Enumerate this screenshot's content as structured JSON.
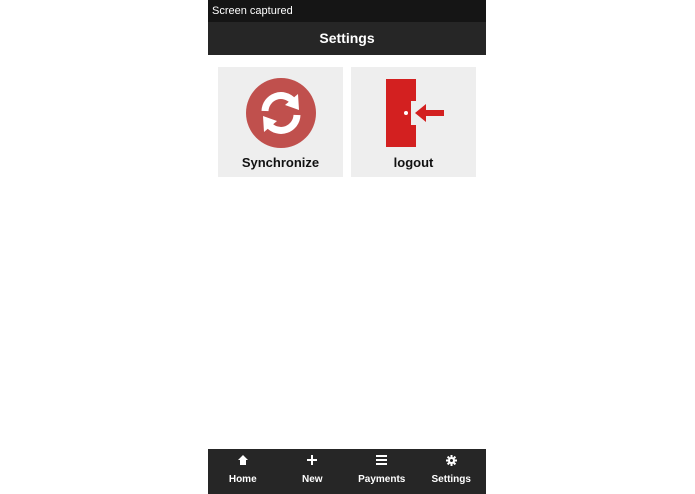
{
  "status_bar": {
    "text": "Screen captured"
  },
  "header": {
    "title": "Settings"
  },
  "tiles": [
    {
      "label": "Synchronize",
      "icon": "sync-icon"
    },
    {
      "label": "logout",
      "icon": "logout-door-icon"
    }
  ],
  "bottom_nav": [
    {
      "label": "Home",
      "icon": "home-icon"
    },
    {
      "label": "New",
      "icon": "plus-icon"
    },
    {
      "label": "Payments",
      "icon": "list-icon"
    },
    {
      "label": "Settings",
      "icon": "gear-icon"
    }
  ],
  "colors": {
    "accent_red": "#c0504d",
    "logout_red": "#d32020",
    "bar_dark": "#262626",
    "tile_bg": "#eeeeee"
  }
}
